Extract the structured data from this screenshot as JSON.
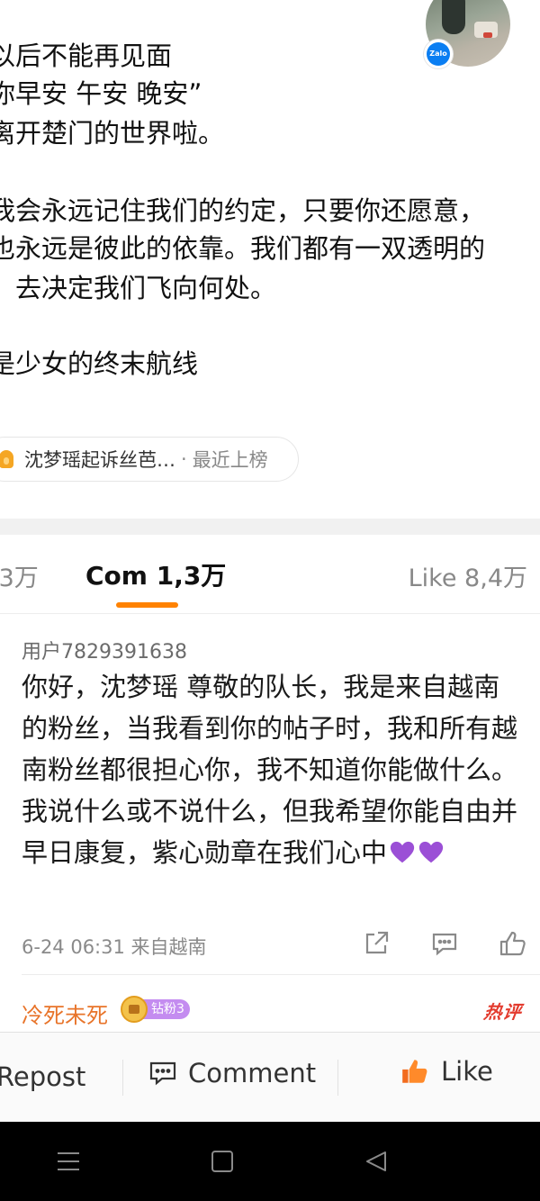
{
  "post": {
    "lines": [
      "以后不能再见面",
      "你早安 午安 晚安”",
      "离开楚门的世界啦。",
      "我会永远记住我们的约定，只要你还愿意，",
      "也永远是彼此的依靠。我们都有一双透明的",
      "，去决定我们飞向何处。",
      "是少女的终末航线"
    ],
    "topic": "沈梦瑶起诉丝芭…",
    "topic_sep": "·",
    "topic_rank": "最近上榜"
  },
  "tabs": {
    "repost": ",3万",
    "comments": "Com 1,3万",
    "likes": "Like 8,4万"
  },
  "comment": {
    "user": "用户7829391638",
    "text": "你好，沈梦瑶 尊敬的队长，我是来自越南的粉丝，当我看到你的帖子时，我和所有越南粉丝都很担心你，我不知道你能做什么。我说什么或不说什么，但我希望你能自由并早日康复，紫心勋章在我们心中",
    "hearts": "💜💜",
    "meta": "6-24 06:31  来自越南"
  },
  "next_comment": {
    "user": "冷死未死",
    "badge": "钻粉3",
    "hot": "热评"
  },
  "actions": {
    "repost": "Repost",
    "comment": "Comment",
    "like": "Like"
  },
  "avatar": {
    "badge_text": "Zalo"
  },
  "colors": {
    "accent": "#ff8200",
    "username_orange": "#e8742a",
    "hot_red": "#e33b2e",
    "heart_purple": "#9b4fd6"
  },
  "icons": {
    "share": "share-icon",
    "reply": "reply-icon",
    "like": "thumb-up-icon",
    "comment": "comment-icon",
    "menu": "menu-icon",
    "home": "home-icon",
    "back": "back-icon"
  }
}
